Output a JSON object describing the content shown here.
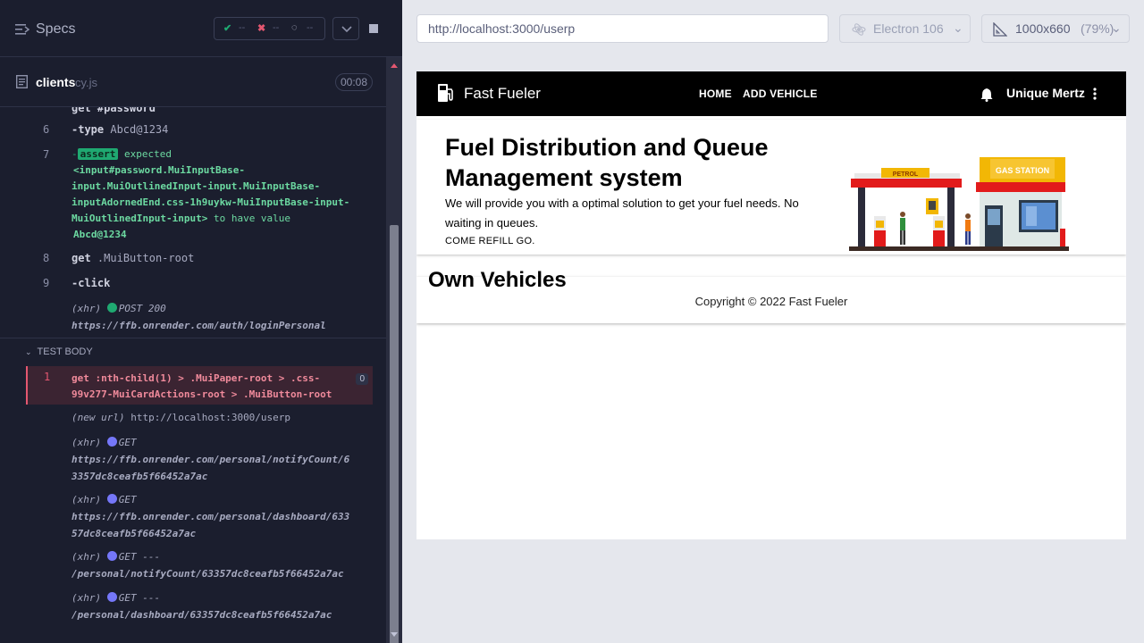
{
  "runner": {
    "specs_label": "Specs",
    "stats": {
      "passed": "--",
      "failed": "--",
      "pending": "--"
    },
    "file": {
      "name": "clients",
      "ext": "cy.js",
      "duration": "00:08"
    },
    "log": [
      {
        "num": "6",
        "cmd": "-type",
        "arg": "Abcd@1234"
      },
      {
        "num": "7",
        "assert_badge": "assert",
        "assert_word": "expected",
        "assert_lines": [
          "<input#password.MuiInputBase-",
          "input.MuiOutlinedInput-input.MuiInputBase-",
          "inputAdornedEnd.css-1h9uykw-MuiInputBase-input-",
          "MuiOutlinedInput-input>"
        ],
        "assert_tail": "to have value",
        "assert_value": "Abcd@1234"
      },
      {
        "num": "8",
        "cmd": "get",
        "arg": ".MuiButton-root"
      },
      {
        "num": "9",
        "cmd": "-click"
      },
      {
        "xhr": "(xhr)",
        "method": "POST 200",
        "url": "https://ffb.onrender.com/auth/loginPersonal"
      }
    ],
    "partial_top": "get  #password",
    "test_body_label": "TEST BODY",
    "failed_cmd": {
      "num": "1",
      "line1": "get  :nth-child(1) > .MuiPaper-root > .css-",
      "line2": "99v277-MuiCardActions-root > .MuiButton-root",
      "count": "0"
    },
    "new_url": {
      "label": "(new url)",
      "url": "http://localhost:3000/userp"
    },
    "xhrs": [
      {
        "label": "(xhr)",
        "method": "GET",
        "line1": "https://ffb.onrender.com/personal/notifyCount/6",
        "line2": "3357dc8ceafb5f66452a7ac"
      },
      {
        "label": "(xhr)",
        "method": "GET",
        "line1": "https://ffb.onrender.com/personal/dashboard/633",
        "line2": "57dc8ceafb5f66452a7ac"
      },
      {
        "label": "(xhr)",
        "method": "GET ---",
        "line1": "/personal/notifyCount/63357dc8ceafb5f66452a7ac",
        "line2": ""
      },
      {
        "label": "(xhr)",
        "method": "GET ---",
        "line1": "/personal/dashboard/63357dc8ceafb5f66452a7ac",
        "line2": ""
      }
    ]
  },
  "browser": {
    "url": "http://localhost:3000/userp",
    "engine": "Electron 106",
    "viewport": "1000x660",
    "zoom": "(79%)"
  },
  "app": {
    "brand": "Fast Fueler",
    "nav": [
      "HOME",
      "ADD VEHICLE"
    ],
    "user": "Unique Mertz",
    "hero_title": "Fuel Distribution and Queue Management system",
    "hero_text": "We will provide you with a optimal solution to get your fuel needs. No waiting in queues.",
    "hero_cta": "COME REFILL GO.",
    "art_petrol": "PETROL",
    "art_station": "GAS STATION",
    "section_title": "Own Vehicles",
    "footer": "Copyright © 2022 Fast Fueler"
  },
  "colors": {
    "pass": "#1fa971",
    "fail": "#e45770",
    "xhr_dot": "#7577f9",
    "post_dot": "#1fa971"
  }
}
